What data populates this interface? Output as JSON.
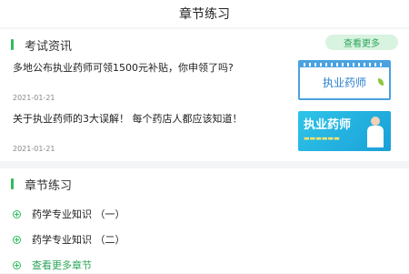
{
  "header": {
    "title": "章节练习"
  },
  "news_section": {
    "title": "考试资讯",
    "more_label": "查看更多",
    "items": [
      {
        "title": "多地公布执业药师可领1500元补贴，你申领了吗?",
        "date": "2021-01-21",
        "thumb_text": "执业药师"
      },
      {
        "title": "关于执业药师的3大误解！ 每个药店人都应该知道！",
        "date": "2021-01-21",
        "thumb_text": "执业药师"
      }
    ]
  },
  "chapter_section": {
    "title": "章节练习",
    "items": [
      {
        "label": "药学专业知识 （一）"
      },
      {
        "label": "药学专业知识 （二）"
      }
    ],
    "more_label": "查看更多章节"
  },
  "colors": {
    "accent": "#2fbb5f",
    "accent_light": "#d9f3e1",
    "background": "#f4f5f7"
  }
}
